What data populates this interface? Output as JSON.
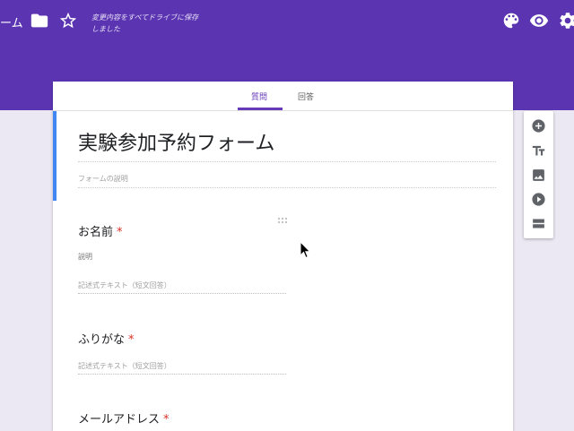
{
  "header": {
    "app_title": "ーム",
    "save_status": "変更内容をすべてドライブに保存しました",
    "icons": [
      "folder-icon",
      "star-icon",
      "palette-icon",
      "eye-icon",
      "gear-icon"
    ],
    "accent_color": "#5b35b1"
  },
  "tabs": [
    {
      "label": "質問",
      "active": true
    },
    {
      "label": "回答",
      "active": false
    }
  ],
  "form": {
    "title": "実験参加予約フォーム",
    "description_placeholder": "フォームの説明"
  },
  "questions": [
    {
      "title": "お名前",
      "required_mark": "*",
      "description": "説明",
      "answer_placeholder": "記述式テキスト（短文回答）"
    },
    {
      "title": "ふりがな",
      "required_mark": "*",
      "answer_placeholder": "記述式テキスト（短文回答）"
    },
    {
      "title": "メールアドレス",
      "required_mark": "*"
    }
  ],
  "side_toolbar": [
    "add-question-icon",
    "title-text-icon",
    "image-icon",
    "video-icon",
    "section-icon"
  ]
}
